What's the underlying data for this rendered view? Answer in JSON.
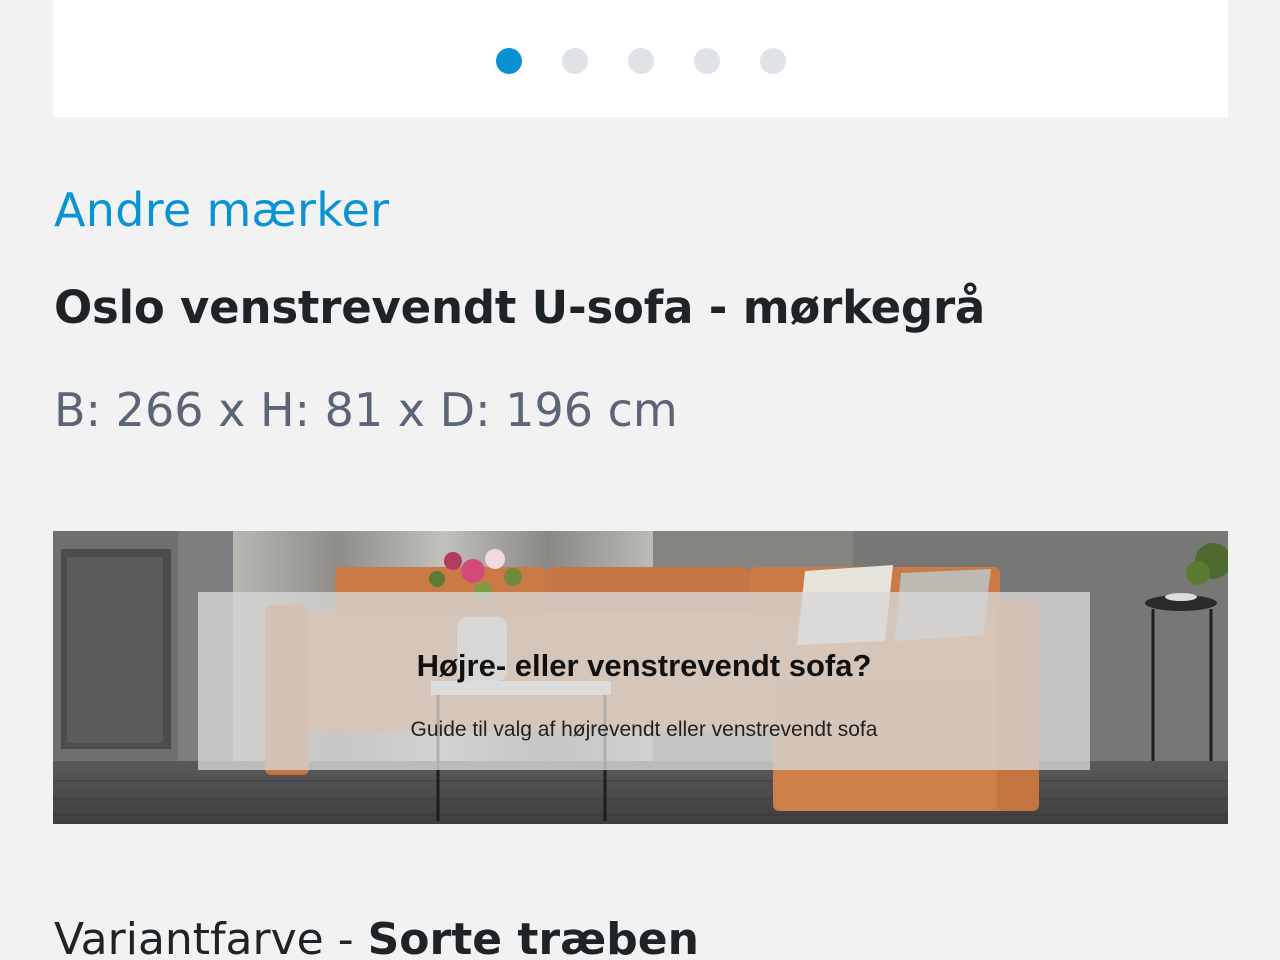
{
  "carousel": {
    "dots": [
      {
        "active": true
      },
      {
        "active": false
      },
      {
        "active": false
      },
      {
        "active": false
      },
      {
        "active": false
      }
    ],
    "active_color": "#0891d1",
    "inactive_color": "#dfe2e6"
  },
  "product": {
    "brand": "Andre mærker",
    "title": "Oslo venstrevendt U-sofa - mørkegrå",
    "dimensions": "B: 266 x H: 81 x D: 196 cm"
  },
  "banner": {
    "heading": "Højre- eller venstrevendt sofa?",
    "subtitle": "Guide til valg af højrevendt eller venstrevendt sofa"
  },
  "variant": {
    "label": "Variantfarve - ",
    "value": "Sorte træben"
  },
  "colors": {
    "accent": "#0a93d4",
    "title": "#1e2328",
    "muted": "#5b6577",
    "background": "#f2f2f3"
  }
}
